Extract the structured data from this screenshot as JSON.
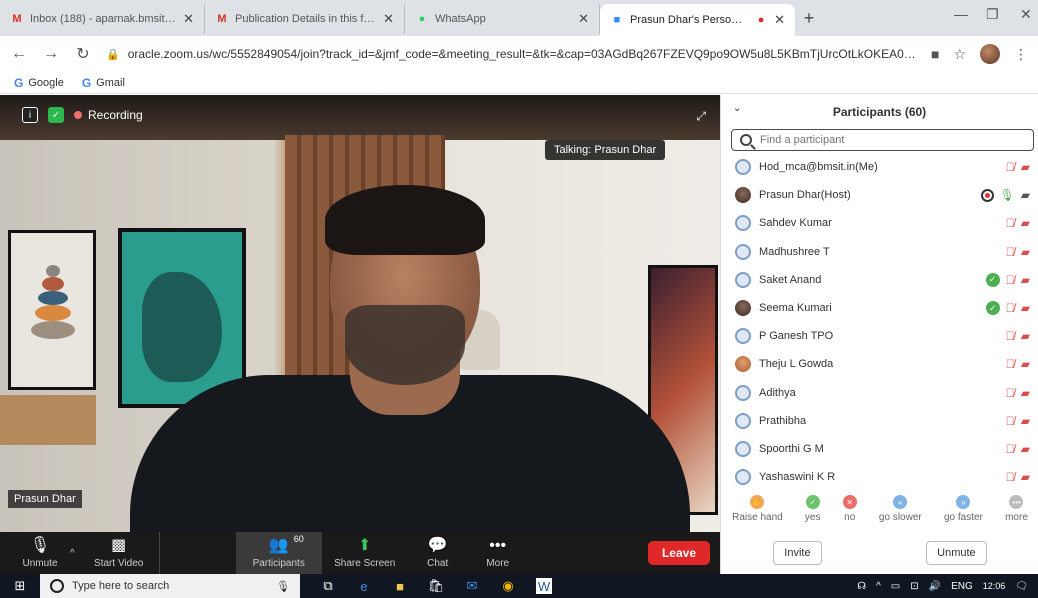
{
  "browser": {
    "tabs": [
      {
        "label": "Inbox (188) - aparnak.bmsit@gm",
        "icon": "gmail-icon"
      },
      {
        "label": "Publication Details in this format",
        "icon": "gmail-icon"
      },
      {
        "label": "WhatsApp",
        "icon": "whatsapp-icon"
      },
      {
        "label": "Prasun Dhar's Personal Meet",
        "icon": "zoom-icon"
      }
    ],
    "url": "oracle.zoom.us/wc/5552849054/join?track_id=&jmf_code=&meeting_result=&tk=&cap=03AGdBq267FZEVQ9po9OW5u8L5KBmTjUrcOtLkOKEA0iu0ki7SFlvOS...",
    "bookmarks": [
      "Google",
      "Gmail"
    ]
  },
  "video": {
    "recording_label": "Recording",
    "talking_label": "Talking: Prasun Dhar",
    "name_tag": "Prasun Dhar"
  },
  "controls": {
    "unmute": "Unmute",
    "start_video": "Start Video",
    "participants": "Participants",
    "participants_count": "60",
    "share_screen": "Share Screen",
    "chat": "Chat",
    "more": "More",
    "leave": "Leave"
  },
  "panel": {
    "title": "Participants (60)",
    "search_placeholder": "Find a participant",
    "participants": [
      {
        "name": "Hod_mca@bmsit.in(Me)",
        "avatar": "default"
      },
      {
        "name": "Prasun Dhar(Host)",
        "avatar": "photo"
      },
      {
        "name": "Sahdev Kumar",
        "avatar": "default"
      },
      {
        "name": "Madhushree T",
        "avatar": "default"
      },
      {
        "name": "Saket Anand",
        "avatar": "default"
      },
      {
        "name": "Seema Kumari",
        "avatar": "photo"
      },
      {
        "name": "P Ganesh TPO",
        "avatar": "default"
      },
      {
        "name": "Theju L Gowda",
        "avatar": "photo2"
      },
      {
        "name": "Adithya",
        "avatar": "default"
      },
      {
        "name": "Prathibha",
        "avatar": "default"
      },
      {
        "name": "Spoorthi G M",
        "avatar": "default"
      },
      {
        "name": "Yashaswini K R",
        "avatar": "default"
      }
    ],
    "reactions": [
      {
        "label": "Raise hand",
        "color": "#f5a35b"
      },
      {
        "label": "yes",
        "color": "#6cc36c"
      },
      {
        "label": "no",
        "color": "#ef6b6b"
      },
      {
        "label": "go slower",
        "color": "#7fb2e5"
      },
      {
        "label": "go faster",
        "color": "#7fb2e5"
      },
      {
        "label": "more",
        "color": "#bbbbbb"
      }
    ],
    "invite": "Invite",
    "unmute": "Unmute"
  },
  "taskbar": {
    "search_placeholder": "Type here to search",
    "language": "ENG",
    "time": "12:06"
  }
}
